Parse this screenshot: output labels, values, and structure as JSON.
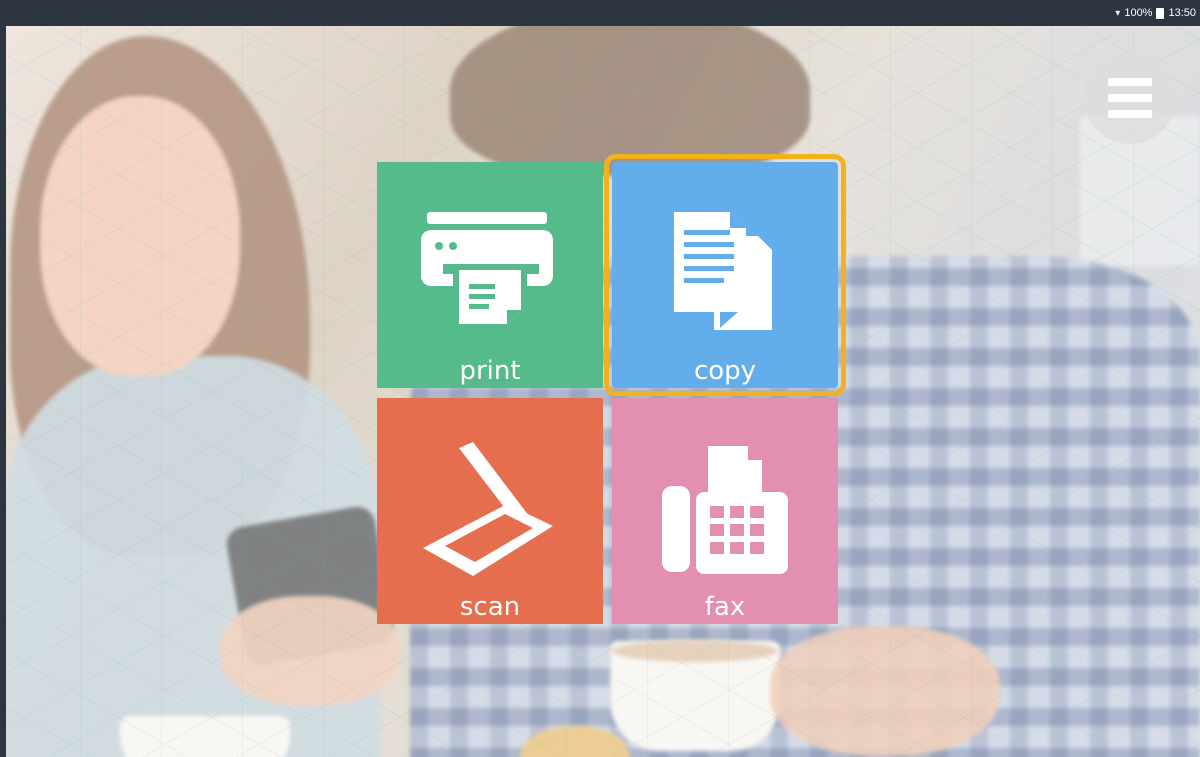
{
  "status_bar": {
    "battery_text": "100%",
    "time": "13:50"
  },
  "menu": {
    "icon": "hamburger-menu-icon"
  },
  "tiles": {
    "print": {
      "label": "print",
      "icon": "printer-icon",
      "color": "#55bb8a"
    },
    "copy": {
      "label": "copy",
      "icon": "copy-documents-icon",
      "color": "#63aeea",
      "selected": true
    },
    "scan": {
      "label": "scan",
      "icon": "scanner-icon",
      "color": "#e56e4e"
    },
    "fax": {
      "label": "fax",
      "icon": "fax-machine-icon",
      "color": "#e28fb1"
    }
  },
  "colors": {
    "selection_outline": "#f3b21b",
    "status_bar_bg": "#2d3540"
  }
}
